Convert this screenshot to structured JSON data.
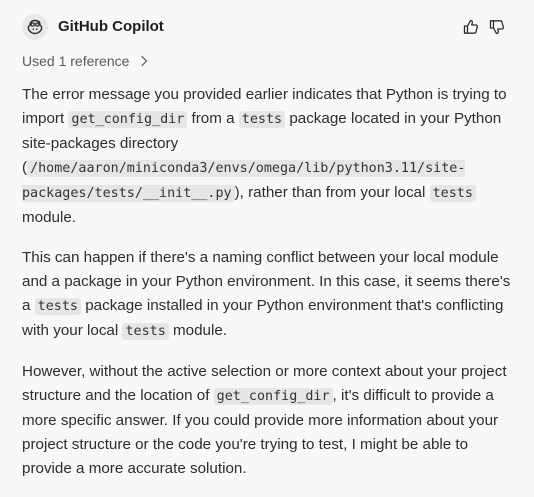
{
  "header": {
    "title": "GitHub Copilot",
    "icons": {
      "avatar": "copilot-icon",
      "upvote": "thumbs-up-icon",
      "downvote": "thumbs-down-icon"
    }
  },
  "references": {
    "label": "Used 1 reference",
    "icon": "chevron-right-icon"
  },
  "message": {
    "p1": {
      "t1": "The error message you provided earlier indicates that Python is trying to import ",
      "c1": "get_config_dir",
      "t2": " from a ",
      "c2": "tests",
      "t3": " package located in your Python site-packages directory (",
      "c3": "/home/aaron/miniconda3/envs/omega/lib/python3.11/site-packages/tests/__init__.py",
      "t4": "), rather than from your local ",
      "c4": "tests",
      "t5": " module."
    },
    "p2": {
      "t1": "This can happen if there's a naming conflict between your local module and a package in your Python environment. In this case, it seems there's a ",
      "c1": "tests",
      "t2": " package installed in your Python environment that's conflicting with your local ",
      "c2": "tests",
      "t3": " module."
    },
    "p3": {
      "t1": "However, without the active selection or more context about your project structure and the location of ",
      "c1": "get_config_dir",
      "t2": ", it's difficult to provide a more specific answer. If you could provide more information about your project structure or the code you're trying to test, I might be able to provide a more accurate solution."
    }
  },
  "colors": {
    "background": "#f8f8f8",
    "code_bg": "#e6e6e6",
    "text": "#2d2d2d"
  }
}
